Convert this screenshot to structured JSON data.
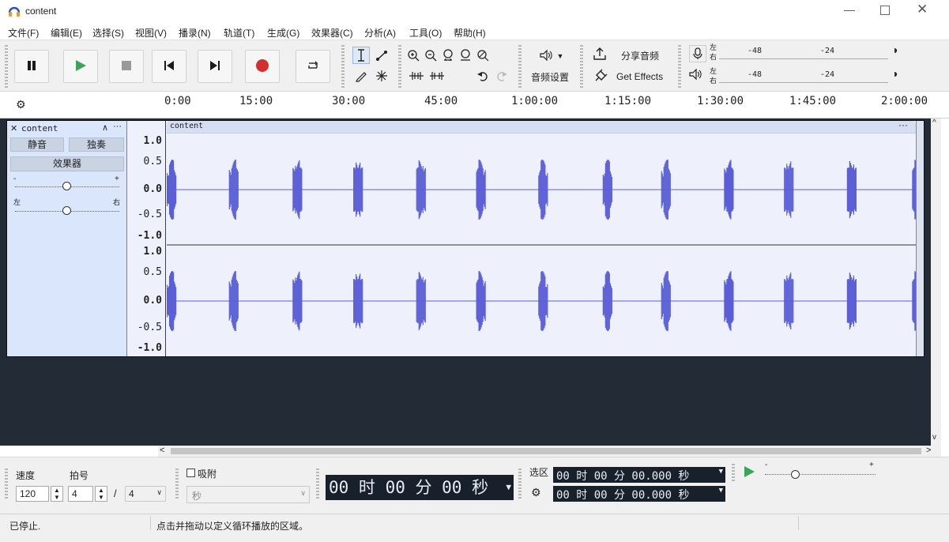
{
  "window": {
    "title": "content"
  },
  "menu": [
    "文件(F)",
    "编辑(E)",
    "选择(S)",
    "视图(V)",
    "播录(N)",
    "轨道(T)",
    "生成(G)",
    "效果器(C)",
    "分析(A)",
    "工具(O)",
    "帮助(H)"
  ],
  "toolbar": {
    "share_label": "分享音频",
    "audio_setup_label": "音频设置",
    "get_effects_label": "Get Effects",
    "meter_left": "左",
    "meter_right": "右",
    "meter_ticks": [
      "-48",
      "-24"
    ]
  },
  "ruler": {
    "ticks": [
      "0:00",
      "15:00",
      "30:00",
      "45:00",
      "1:00:00",
      "1:15:00",
      "1:30:00",
      "1:45:00",
      "2:00:00"
    ]
  },
  "track": {
    "name": "content",
    "clip_name": "content",
    "mute_label": "静音",
    "solo_label": "独奏",
    "effects_label": "效果器",
    "gain_minus": "-",
    "gain_plus": "+",
    "pan_left": "左",
    "pan_right": "右",
    "gain_value": 0.5,
    "pan_value": 0.5,
    "scale_labels": [
      "1.0",
      "0.5",
      "0.0",
      "-0.5",
      "-1.0"
    ],
    "burst_positions_pct": [
      0,
      8.3,
      16.8,
      24.9,
      33.3,
      41.3,
      49.6,
      58.2,
      66.0,
      74.4,
      82.4,
      90.8,
      99.5
    ]
  },
  "colors": {
    "waveform": "#5b5fd6",
    "track_bg": "#eef1fb",
    "header_bg": "#d9e6fb",
    "play_green": "#3aa457",
    "record_red": "#d32f2f"
  },
  "bottom": {
    "tempo_label": "速度",
    "tempo_value": "120",
    "meter_label": "拍号",
    "meter_upper": "4",
    "meter_slash": "/",
    "meter_lower": "4",
    "snap_label": "吸附",
    "snap_unit": "秒",
    "time_display": "00 时 00 分 00 秒",
    "selection_label": "选区",
    "sel_start": "00 时 00 分 00.000 秒",
    "sel_end": "00 时 00 分 00.000 秒",
    "playback_speed_minus": "-",
    "playback_speed_plus": "+",
    "playback_speed_value": 0.28
  },
  "status": {
    "state": "已停止.",
    "hint": "点击并拖动以定义循环播放的区域。"
  }
}
